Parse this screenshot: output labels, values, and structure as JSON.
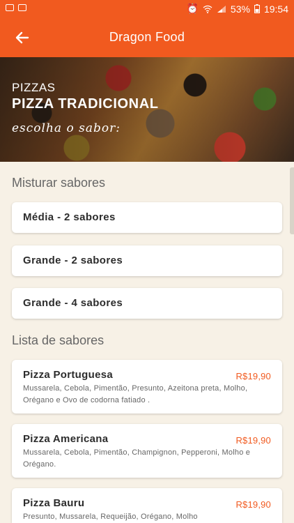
{
  "status": {
    "battery": "53%",
    "time": "19:54"
  },
  "appbar": {
    "title": "Dragon Food"
  },
  "hero": {
    "category": "PIZZAS",
    "product": "PIZZA TRADICIONAL",
    "choose": "escolha o sabor:"
  },
  "mix": {
    "title": "Misturar sabores",
    "options": [
      {
        "label": "Média - 2 sabores"
      },
      {
        "label": "Grande - 2 sabores"
      },
      {
        "label": "Grande - 4 sabores"
      }
    ]
  },
  "flavors": {
    "title": "Lista de sabores",
    "items": [
      {
        "name": "Pizza Portuguesa",
        "price": "R$19,90",
        "desc": "Mussarela, Cebola, Pimentão, Presunto, Azeitona preta, Molho, Orégano e Ovo de codorna fatiado ."
      },
      {
        "name": "Pizza Americana",
        "price": "R$19,90",
        "desc": "Mussarela, Cebola, Pimentão, Champignon, Pepperoni, Molho e Orégano."
      },
      {
        "name": "Pizza Bauru",
        "price": "R$19,90",
        "desc": "Presunto, Mussarela, Requeijão, Orégano, Molho"
      }
    ]
  },
  "colors": {
    "accent": "#f15a1f",
    "background": "#f7f1e6"
  }
}
